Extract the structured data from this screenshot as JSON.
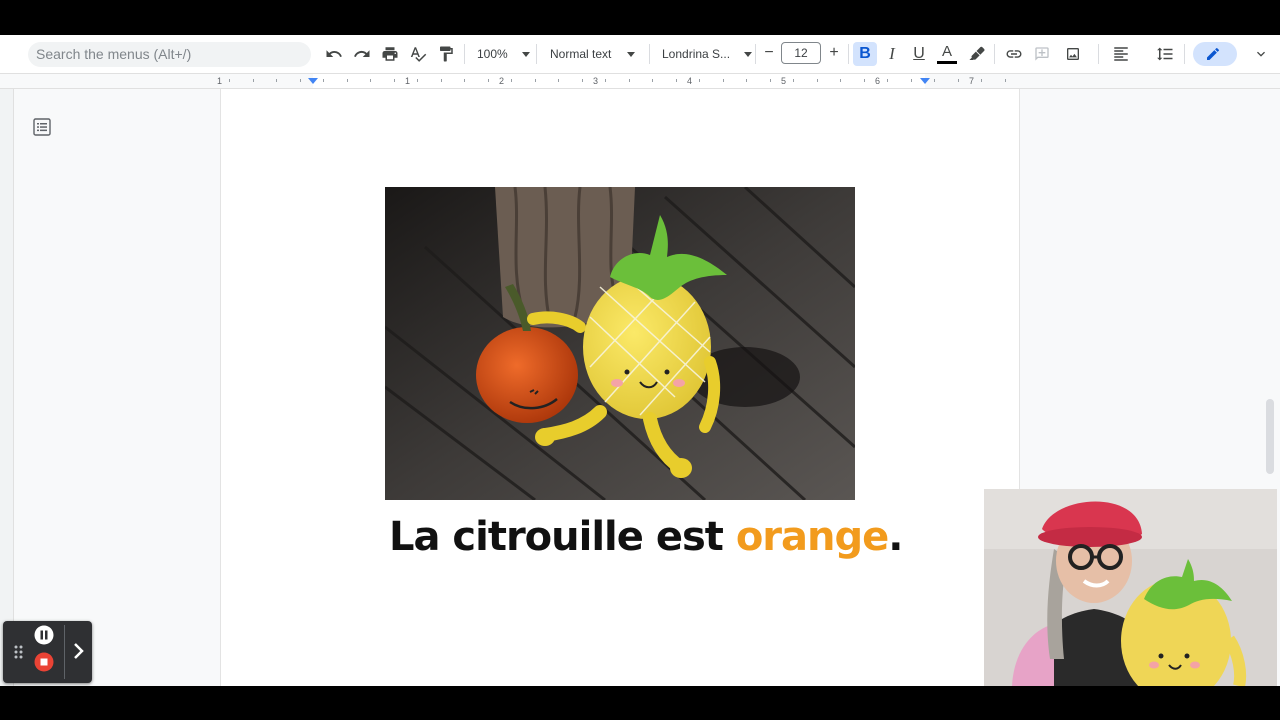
{
  "toolbar": {
    "search_placeholder": "Search the menus (Alt+/)",
    "zoom": "100%",
    "style": "Normal text",
    "font": "Londrina S...",
    "font_size": "12",
    "minus": "−",
    "plus": "+",
    "bold": "B",
    "italic": "I",
    "underline": "U",
    "text_color": "A"
  },
  "ruler": {
    "numbers": [
      "1",
      "1",
      "2",
      "3",
      "4",
      "5",
      "6",
      "7"
    ]
  },
  "document": {
    "caption_main": "La citrouille est ",
    "caption_color_word": "orange",
    "caption_end": ".",
    "accent_color": "#f29b1d"
  }
}
